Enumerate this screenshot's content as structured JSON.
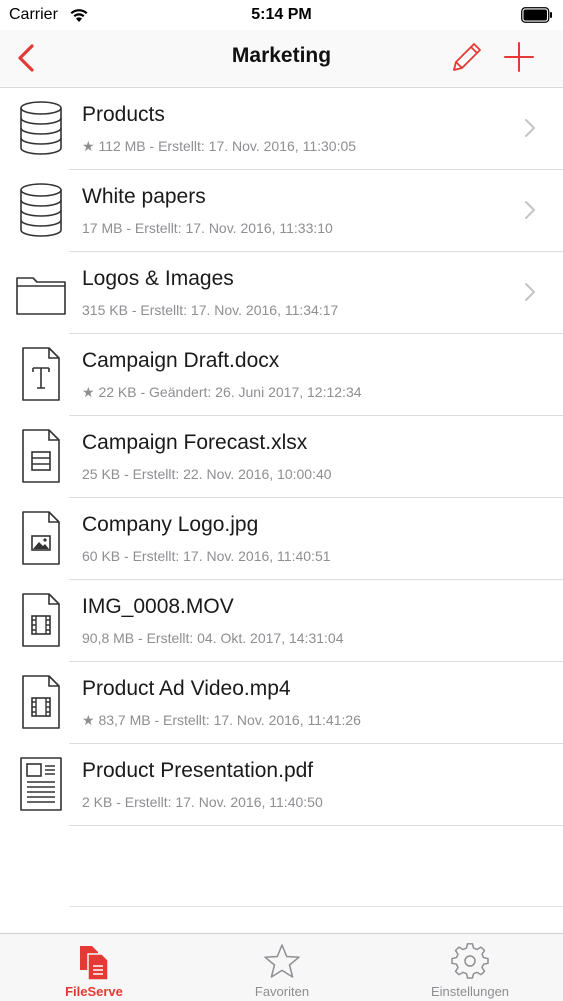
{
  "status_bar": {
    "carrier": "Carrier",
    "time": "5:14 PM"
  },
  "nav": {
    "title": "Marketing",
    "back_icon": "chevron-left-icon",
    "edit_icon": "pencil-icon",
    "add_icon": "plus-icon"
  },
  "colors": {
    "accent": "#e53935",
    "icon": "#333333",
    "subtitle": "#8e8e93",
    "separator": "#dcdcdc"
  },
  "items": [
    {
      "title": "Products",
      "subtitle": "★ 112 MB - Erstellt: 17. Nov. 2016, 11:30:05",
      "icon": "database-icon",
      "chevron": true
    },
    {
      "title": "White papers",
      "subtitle": "17 MB - Erstellt: 17. Nov. 2016, 11:33:10",
      "icon": "database-icon",
      "chevron": true
    },
    {
      "title": "Logos & Images",
      "subtitle": "315 KB - Erstellt: 17. Nov. 2016, 11:34:17",
      "icon": "folder-icon",
      "chevron": true
    },
    {
      "title": "Campaign Draft.docx",
      "subtitle": "★ 22 KB - Geändert: 26. Juni 2017, 12:12:34",
      "icon": "text-document-icon",
      "chevron": false
    },
    {
      "title": "Campaign Forecast.xlsx",
      "subtitle": "25 KB - Erstellt: 22. Nov. 2016, 10:00:40",
      "icon": "spreadsheet-document-icon",
      "chevron": false
    },
    {
      "title": "Company Logo.jpg",
      "subtitle": "60 KB - Erstellt: 17. Nov. 2016, 11:40:51",
      "icon": "image-document-icon",
      "chevron": false
    },
    {
      "title": "IMG_0008.MOV",
      "subtitle": "90,8 MB - Erstellt: 04. Okt. 2017, 14:31:04",
      "icon": "video-document-icon",
      "chevron": false
    },
    {
      "title": "Product Ad Video.mp4",
      "subtitle": "★ 83,7 MB - Erstellt: 17. Nov. 2016, 11:41:26",
      "icon": "video-document-icon",
      "chevron": false
    },
    {
      "title": "Product Presentation.pdf",
      "subtitle": "2 KB - Erstellt: 17. Nov. 2016, 11:40:50",
      "icon": "pdf-document-icon",
      "chevron": false
    }
  ],
  "tabs": [
    {
      "label": "FileServe",
      "icon": "files-icon",
      "active": true
    },
    {
      "label": "Favoriten",
      "icon": "star-icon",
      "active": false
    },
    {
      "label": "Einstellungen",
      "icon": "gear-icon",
      "active": false
    }
  ]
}
